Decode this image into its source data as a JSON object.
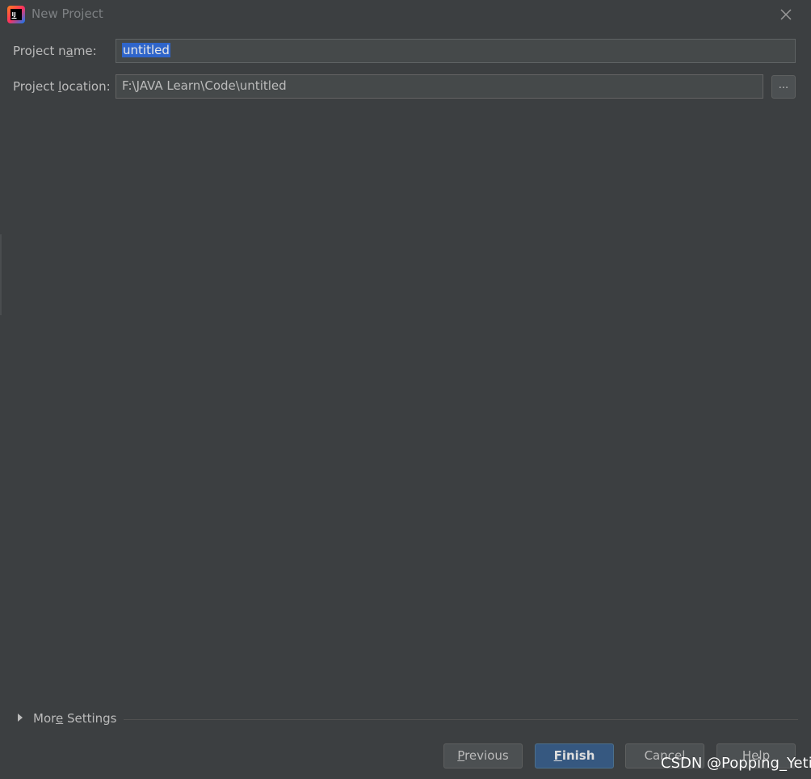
{
  "window": {
    "title": "New Project",
    "icon": "intellij-idea-icon",
    "close_icon": "close-icon"
  },
  "form": {
    "project_name": {
      "label_before": "Project n",
      "label_mnemonic": "a",
      "label_after": "me:",
      "value": "untitled"
    },
    "project_location": {
      "label_before": "Project ",
      "label_mnemonic": "l",
      "label_after": "ocation:",
      "value": "F:\\JAVA Learn\\Code\\untitled",
      "browse_label": "..."
    }
  },
  "more_settings": {
    "label_before": "Mor",
    "label_mnemonic": "e",
    "label_after": " Settings",
    "expanded": false
  },
  "buttons": {
    "previous": {
      "mnemonic": "P",
      "rest": "revious"
    },
    "finish": {
      "mnemonic": "F",
      "rest": "inish"
    },
    "cancel": {
      "label": "Cancel"
    },
    "help": {
      "label": "Help"
    }
  },
  "watermark": "CSDN @Popping_Yeti",
  "colors": {
    "background": "#3c3f41",
    "field_background": "#45494a",
    "selection": "#2f65ca",
    "primary_button": "#365880",
    "text": "#bbbbbb"
  }
}
